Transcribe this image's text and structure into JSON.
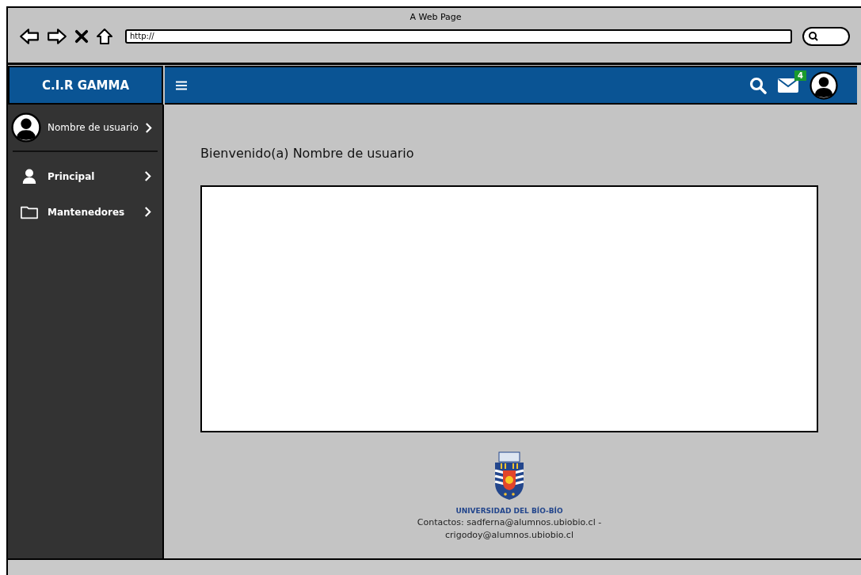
{
  "browser": {
    "title": "A Web Page",
    "url": "http://"
  },
  "app": {
    "brand": "C.I.R GAMMA",
    "notification_count": "4"
  },
  "sidebar": {
    "user": "Nombre de usuario",
    "items": [
      {
        "label": "Principal",
        "kind": "user"
      },
      {
        "label": "Mantenedores",
        "kind": "folder"
      }
    ]
  },
  "content": {
    "greeting": "Bienvenido(a) Nombre de usuario"
  },
  "footer": {
    "university": "UNIVERSIDAD DEL BÍO-BÍO",
    "contacts": "Contactos: sadferna@alumnos.ubiobio.cl - crigodoy@alumnos.ubiobio.cl"
  }
}
